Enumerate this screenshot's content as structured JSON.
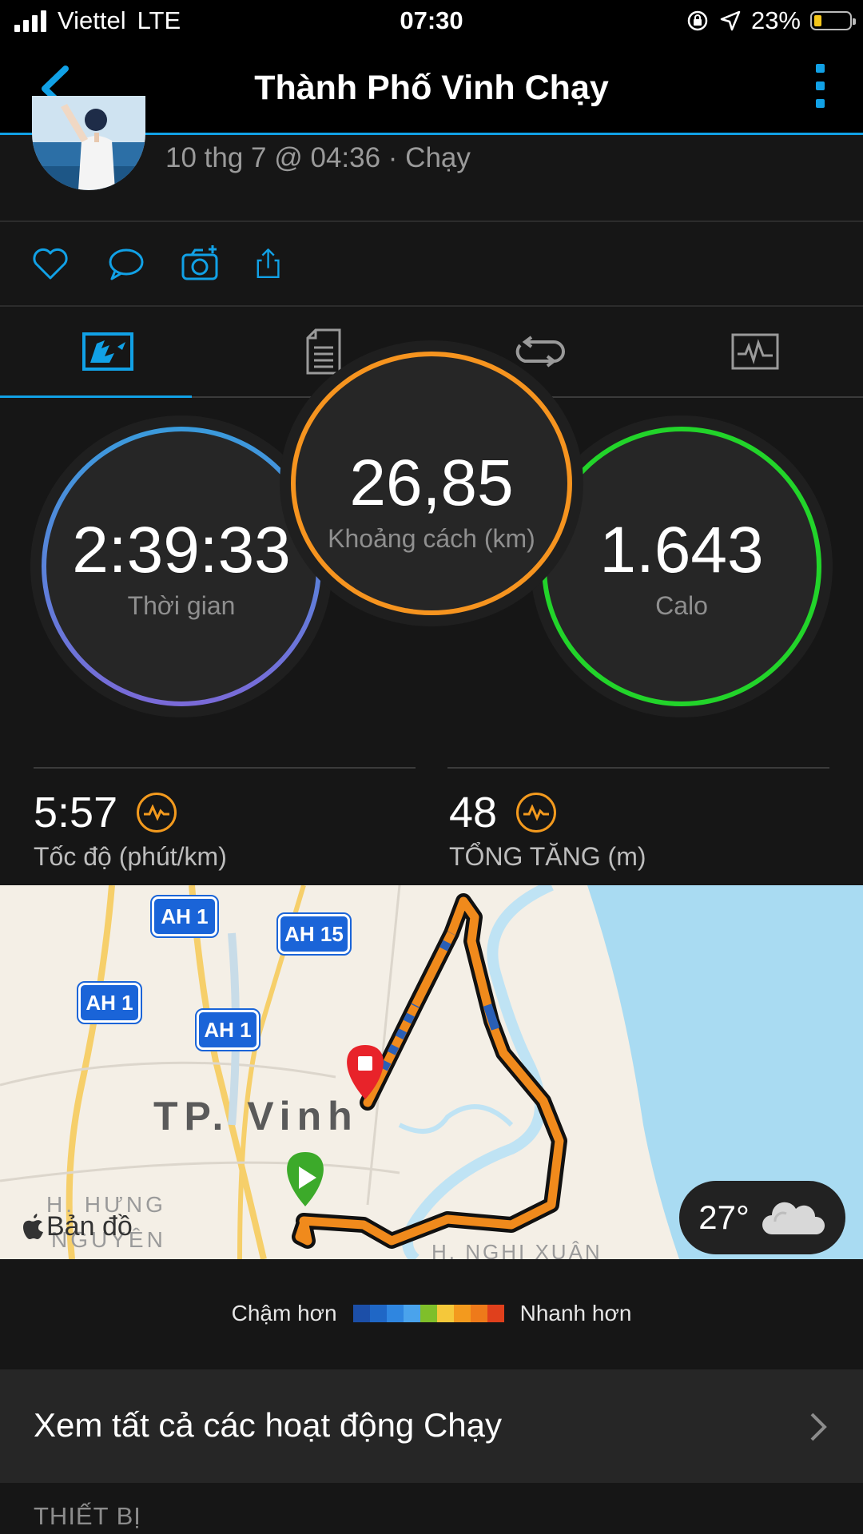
{
  "status_bar": {
    "carrier": "Viettel",
    "network": "LTE",
    "time": "07:30",
    "battery": "23%"
  },
  "nav": {
    "title": "Thành Phố Vinh Chạy"
  },
  "header": {
    "subtitle": "10 thg 7 @ 04:36 · Chạy"
  },
  "metrics": {
    "time": {
      "value": "2:39:33",
      "label": "Thời gian"
    },
    "distance": {
      "value": "26,85",
      "label": "Khoảng cách (km)"
    },
    "calories": {
      "value": "1.643",
      "label": "Calo"
    }
  },
  "stats": {
    "pace": {
      "value": "5:57",
      "label": "Tốc độ (phút/km)"
    },
    "elevation": {
      "value": "48",
      "label": "TỔNG TĂNG (m)"
    }
  },
  "map": {
    "city_label": "TP. Vinh",
    "district_left": "H. HƯNG",
    "district_left2": "NGUYÊN",
    "district_right": "H. NGHI XUÂN",
    "attribution": "Bản đồ",
    "road_signs": [
      "AH 1",
      "AH 15",
      "AH 1",
      "AH 1"
    ],
    "weather_temp": "27°"
  },
  "legend": {
    "slower": "Chậm hơn",
    "faster": "Nhanh hơn",
    "colors": [
      "#1c4fa8",
      "#1f67c6",
      "#2f86e0",
      "#4aa3ec",
      "#7fbf2a",
      "#f5c83a",
      "#f39a1e",
      "#ee7a1a",
      "#e0401c"
    ]
  },
  "view_all": {
    "label": "Xem tất cả các hoạt động Chạy"
  },
  "section": {
    "device": "THIẾT BỊ"
  }
}
